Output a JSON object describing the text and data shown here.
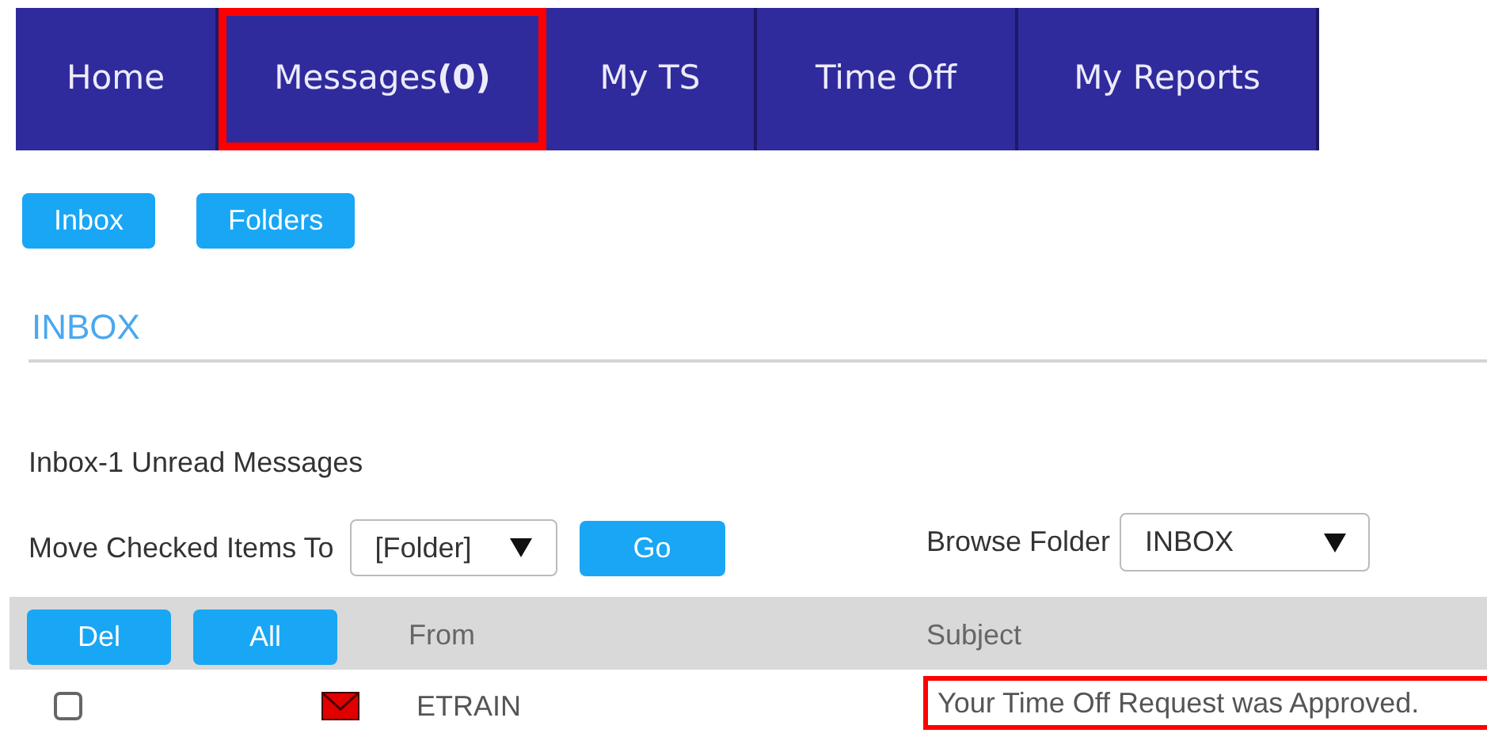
{
  "nav_tabs": [
    {
      "label": "Home",
      "highlighted": false
    },
    {
      "label": "Messages",
      "count": "(0)",
      "highlighted": true
    },
    {
      "label": "My TS",
      "highlighted": false
    },
    {
      "label": "Time Off",
      "highlighted": false
    },
    {
      "label": "My Reports",
      "highlighted": false
    }
  ],
  "sub_buttons": [
    "Inbox",
    "Folders"
  ],
  "heading": "INBOX",
  "unread_summary": "Inbox-1 Unread Messages",
  "move_label": "Move Checked Items To",
  "move_select": "[Folder]",
  "go_button": "Go",
  "browse_label": "Browse Folder",
  "browse_select": "INBOX",
  "table": {
    "buttons": [
      "Del",
      "All"
    ],
    "columns": [
      "From",
      "Subject"
    ],
    "rows": [
      {
        "checked": false,
        "unread": true,
        "from": "ETRAIN",
        "subject": "Your Time Off Request was Approved.",
        "highlighted": true
      }
    ]
  }
}
